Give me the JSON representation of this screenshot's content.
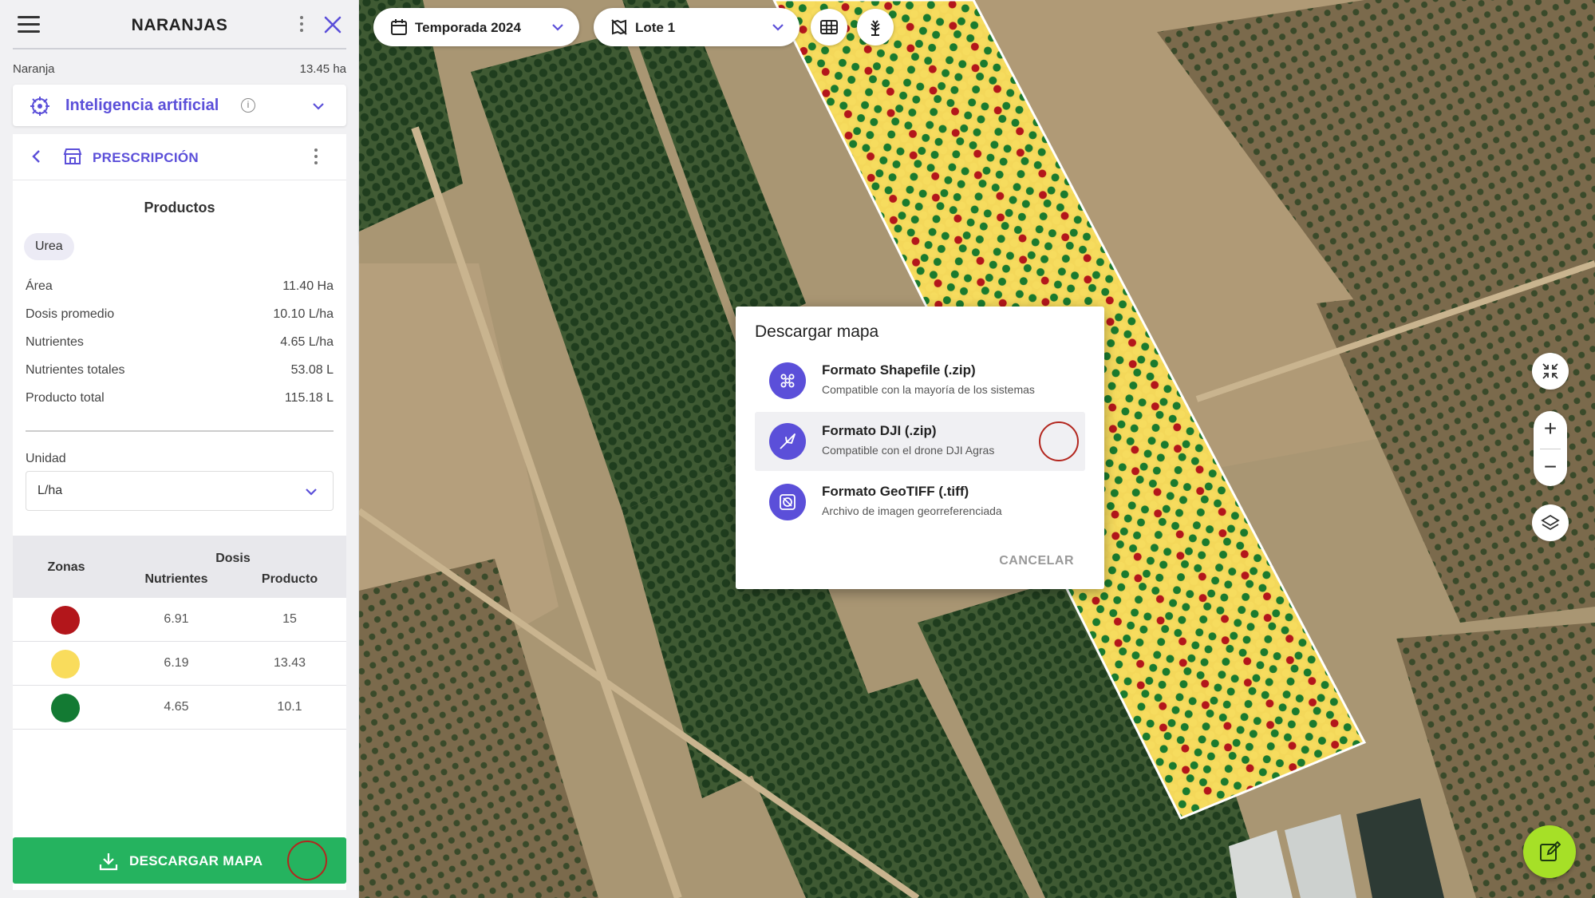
{
  "header": {
    "title": "NARANJAS"
  },
  "crop": {
    "name": "Naranja",
    "area": "13.45 ha"
  },
  "ai_section": {
    "label": "Inteligencia artificial",
    "info": "i"
  },
  "prescription": {
    "title": "PRESCRIPCIÓN",
    "products_title": "Productos",
    "product_chip": "Urea",
    "stats": [
      {
        "label": "Área",
        "value": "11.40 Ha"
      },
      {
        "label": "Dosis promedio",
        "value": "10.10 L/ha"
      },
      {
        "label": "Nutrientes",
        "value": "4.65 L/ha"
      },
      {
        "label": "Nutrientes totales",
        "value": "53.08 L"
      },
      {
        "label": "Producto total",
        "value": "115.18 L"
      }
    ],
    "unit_label": "Unidad",
    "unit_value": "L/ha",
    "zones_table": {
      "zones_header": "Zonas",
      "dose_header": "Dosis",
      "nutrients_header": "Nutrientes",
      "product_header": "Producto",
      "rows": [
        {
          "color": "#b3161b",
          "nutrients": "6.91",
          "product": "15"
        },
        {
          "color": "#f9dc5c",
          "nutrients": "6.19",
          "product": "13.43"
        },
        {
          "color": "#137a33",
          "nutrients": "4.65",
          "product": "10.1"
        }
      ]
    },
    "download_label": "DESCARGAR MAPA"
  },
  "map": {
    "season": "Temporada 2024",
    "lot": "Lote 1",
    "zoom_in": "+",
    "zoom_out": "−"
  },
  "modal": {
    "title": "Descargar mapa",
    "options": [
      {
        "title": "Formato Shapefile (.zip)",
        "subtitle": "Compatible con la mayoría de los sistemas",
        "icon": "shapefile-icon"
      },
      {
        "title": "Formato DJI (.zip)",
        "subtitle": "Compatible con el drone DJI Agras",
        "icon": "drone-icon"
      },
      {
        "title": "Formato GeoTIFF (.tiff)",
        "subtitle": "Archivo de imagen georreferenciada",
        "icon": "geotiff-icon"
      }
    ],
    "cancel": "CANCELAR"
  },
  "colors": {
    "accent": "#5b4fd9",
    "download": "#25b35f",
    "fab": "#a6e027"
  }
}
